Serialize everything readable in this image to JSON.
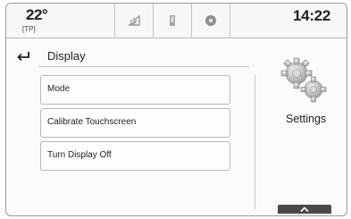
{
  "status": {
    "temperature": "22°",
    "temperature_mode": "[TP]",
    "time": "14:22",
    "tabs": [
      {
        "icon": "audio-icon"
      },
      {
        "icon": "phone-icon"
      },
      {
        "icon": "navigation-icon"
      }
    ]
  },
  "screen": {
    "title": "Display",
    "back_icon": "back-arrow-icon"
  },
  "menu": {
    "items": [
      {
        "label": "Mode"
      },
      {
        "label": "Calibrate Touchscreen"
      },
      {
        "label": "Turn Display Off"
      }
    ]
  },
  "side": {
    "icon": "gears-icon",
    "label": "Settings"
  },
  "scroll": {
    "icon": "chevron-up-icon"
  }
}
